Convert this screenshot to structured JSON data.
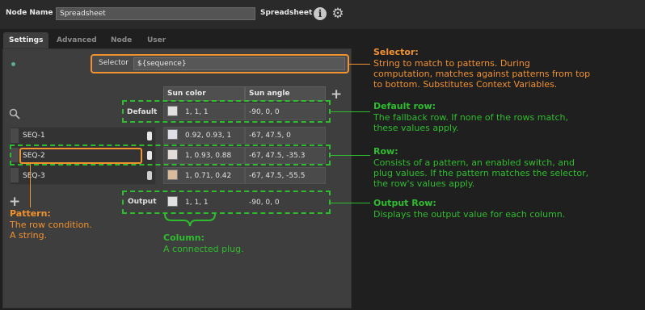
{
  "header": {
    "node_name_label": "Node Name",
    "node_name_value": "Spreadsheet",
    "node_type": "Spreadsheet",
    "info_glyph": "i",
    "info_icon": "info-icon",
    "gear_icon": "gear-icon"
  },
  "tabs": [
    {
      "label": "Settings",
      "active": true
    },
    {
      "label": "Advanced",
      "active": false
    },
    {
      "label": "Node",
      "active": false
    },
    {
      "label": "User",
      "active": false
    }
  ],
  "selector": {
    "label": "Selector",
    "value": "${sequence}"
  },
  "columns": [
    "Sun color",
    "Sun angle"
  ],
  "default_row": {
    "label": "Default",
    "color": "1, 1, 1",
    "color_swatch": "#e0e0e0",
    "angle": "-90, 0, 0"
  },
  "rows": [
    {
      "pattern": "SEQ-1",
      "enabled": true,
      "color": "0.92, 0.93, 1",
      "color_swatch": "#dedfe6",
      "angle": "-67, 47.5, 0"
    },
    {
      "pattern": "SEQ-2",
      "enabled": true,
      "color": "1, 0.93, 0.88",
      "color_swatch": "#e4dcd8",
      "angle": "-67, 47.5, -35.3"
    },
    {
      "pattern": "SEQ-3",
      "enabled": true,
      "color": "1, 0.71, 0.42",
      "color_swatch": "#d9bb9c",
      "angle": "-67, 47.5, -55.5"
    }
  ],
  "output_row": {
    "label": "Output",
    "color": "1, 1, 1",
    "color_swatch": "#e0e0e0",
    "angle": "-90, 0, 0"
  },
  "annotations": {
    "selector": {
      "title": "Selector:",
      "text": [
        "String to match to patterns. During",
        "computation, matches against patterns from top",
        "to bottom. Substitutes Context Variables."
      ]
    },
    "default_row": {
      "title": "Default row:",
      "text": [
        "The fallback row. If none of the rows match,",
        "these values apply."
      ]
    },
    "row": {
      "title": "Row:",
      "text": [
        "Consists of a pattern, an enabled switch, and",
        "plug values. If the pattern matches the selector,",
        "the row's values apply."
      ]
    },
    "output_row": {
      "title": "Output Row:",
      "text": [
        "Displays the output value for each column."
      ]
    },
    "pattern": {
      "title": "Pattern:",
      "text": [
        "The row condition.",
        "A string."
      ]
    },
    "column": {
      "title": "Column:",
      "text": [
        "A connected plug."
      ]
    }
  },
  "colors": {
    "annotation_orange": "#f0922e",
    "annotation_green": "#2ebd2e",
    "panel_bg": "#3e3e3e"
  }
}
